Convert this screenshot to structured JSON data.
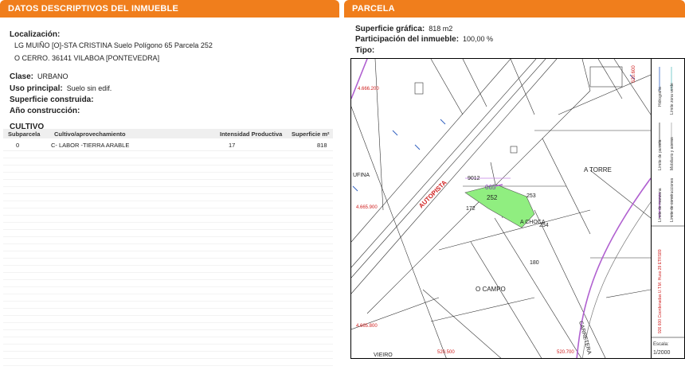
{
  "left_panel": {
    "title": "DATOS DESCRIPTIVOS DEL INMUEBLE",
    "localizacion_label": "Localización:",
    "localizacion_line1": "LG MUIÑO [O]-STA CRISTINA  Suelo Polígono 65 Parcela 252",
    "localizacion_line2": "O CERRO. 36141 VILABOA [PONTEVEDRA]",
    "clase_label": "Clase:",
    "clase_value": "URBANO",
    "uso_label": "Uso principal:",
    "uso_value": "Suelo sin edif.",
    "superficie_label": "Superficie construida:",
    "anio_label": "Año construcción:",
    "cultivo_title": "CULTIVO",
    "table": {
      "headers": [
        "Subparcela",
        "Cultivo/aprovechamiento",
        "Intensidad Productiva",
        "Superficie m²"
      ],
      "rows": [
        [
          "0",
          "C- LABOR -TIERRA ARABLE",
          "17",
          "818"
        ]
      ]
    }
  },
  "right_panel": {
    "title": "PARCELA",
    "superficie_label": "Superficie gráfica:",
    "superficie_value": "818 m2",
    "participacion_label": "Participación del inmueble:",
    "participacion_value": "100,00 %",
    "tipo_label": "Tipo:",
    "map": {
      "labels": {
        "autopista": "AUTOPISTA",
        "a_torre": "A TORRE",
        "a_choca": "A CHOCA",
        "o_campo": "O CAMPO",
        "carretera": "CARRETERA",
        "vieiro": "VIEIRO",
        "ufina": "UFINA",
        "parcel_252": "252",
        "parcel_253": "253",
        "parcel_254": "254",
        "parcel_172": "172",
        "parcel_180": "180",
        "parcel_9012": "9012",
        "poly_065": "065",
        "coord_y1": "4.666.200",
        "coord_y2": "4.665.900",
        "coord_y3": "4.665.800",
        "coord_x1": "520.500",
        "coord_x2": "520.700",
        "coord_x3": "520.600",
        "escala_label": "Escala:",
        "escala_value": "1/2000"
      },
      "legend": [
        "Límite de manzana",
        "Límite de parcela",
        "Límite de construcciones",
        "Mobiliario y aceras",
        "Límite zona verde",
        "Hidrografía"
      ],
      "legend_note": "926 600 Coordenadas U.T.M. Huso 29 ETRS89",
      "colors": {
        "parcel_fill": "#90ee80",
        "road_purple": "#b060d0",
        "orange_header": "#f07e1c"
      }
    }
  }
}
